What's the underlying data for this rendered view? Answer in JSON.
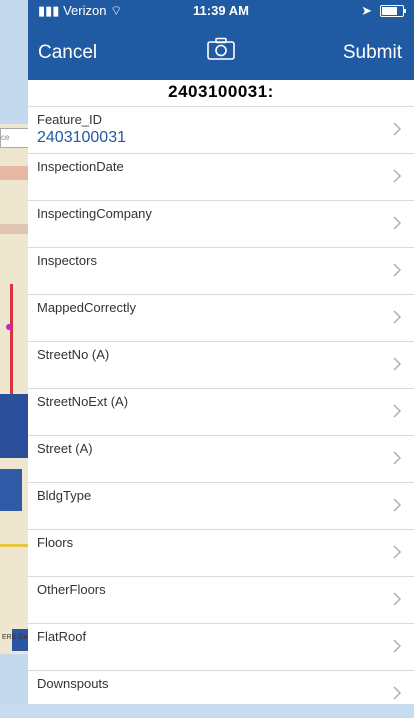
{
  "status": {
    "carrier": "Verizon",
    "time": "11:39 AM"
  },
  "nav": {
    "cancel": "Cancel",
    "submit": "Submit"
  },
  "title": "2403100031:",
  "fields": [
    {
      "label": "Feature_ID",
      "value": "2403100031"
    },
    {
      "label": "InspectionDate",
      "value": ""
    },
    {
      "label": "InspectingCompany",
      "value": ""
    },
    {
      "label": "Inspectors",
      "value": ""
    },
    {
      "label": "MappedCorrectly",
      "value": ""
    },
    {
      "label": "StreetNo (A)",
      "value": ""
    },
    {
      "label": "StreetNoExt (A)",
      "value": ""
    },
    {
      "label": "Street (A)",
      "value": ""
    },
    {
      "label": "BldgType",
      "value": ""
    },
    {
      "label": "Floors",
      "value": ""
    },
    {
      "label": "OtherFloors",
      "value": ""
    },
    {
      "label": "FlatRoof",
      "value": ""
    },
    {
      "label": "Downspouts",
      "value": ""
    }
  ],
  "background": {
    "search_placeholder": "ce",
    "map_credit": "ERE Ge"
  },
  "colors": {
    "accent": "#1f5aa3",
    "separator": "#d9d9d9"
  },
  "icons": {
    "nav_center": "camera-icon",
    "row_accessory": "chevron-right-icon"
  }
}
